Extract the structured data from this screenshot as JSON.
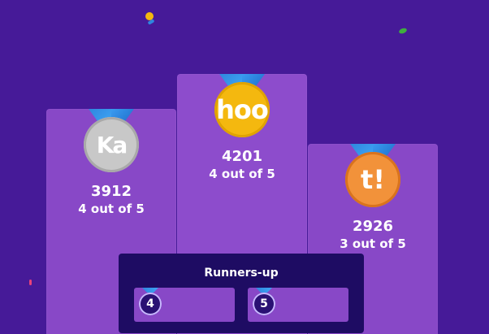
{
  "podium": {
    "first": {
      "medal_text": "hoo",
      "score": "4201",
      "correct": "4 out of 5"
    },
    "second": {
      "medal_text": "Ka",
      "score": "3912",
      "correct": "4 out of 5"
    },
    "third": {
      "medal_text": "t!",
      "score": "2926",
      "correct": "3 out of 5"
    }
  },
  "runners_up": {
    "title": "Runners-up",
    "items": [
      {
        "rank": "4"
      },
      {
        "rank": "5"
      }
    ]
  },
  "colors": {
    "background": "#461a98",
    "podium": "#8848c7",
    "panel": "#1e0c63",
    "gold": "#f4b80f",
    "silver": "#c8c8c8",
    "bronze": "#f2923a",
    "ribbon": "#3ea4f3"
  },
  "icons": {
    "gold_medal": "gold-medal-icon",
    "silver_medal": "silver-medal-icon",
    "bronze_medal": "bronze-medal-icon"
  }
}
